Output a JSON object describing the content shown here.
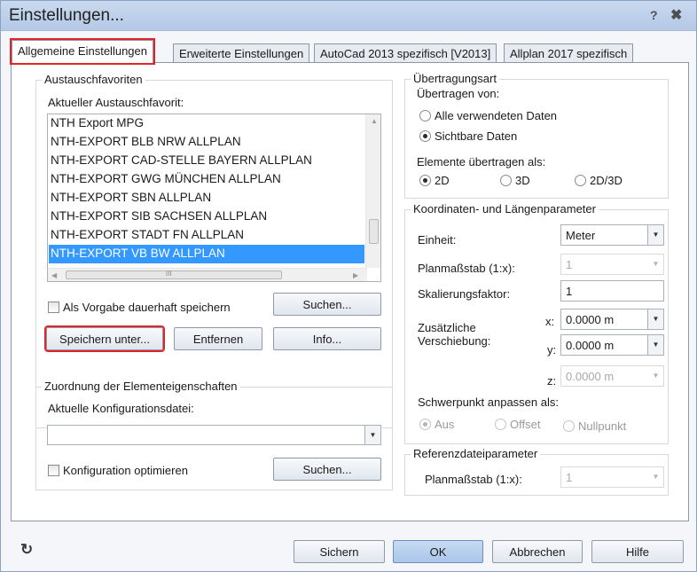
{
  "window": {
    "title": "Einstellungen...",
    "help_glyph": "?",
    "close_glyph": "✖"
  },
  "tabs": [
    {
      "label": "Allgemeine Einstellungen",
      "active": true
    },
    {
      "label": "Erweiterte Einstellungen",
      "active": false
    },
    {
      "label": "AutoCad 2013 spezifisch [V2013]",
      "active": false
    },
    {
      "label": "Allplan 2017 spezifisch",
      "active": false
    }
  ],
  "favorites": {
    "group_title": "Austauschfavoriten",
    "list_label": "Aktueller Austauschfavorit:",
    "items": [
      "NTH Export MPG",
      "NTH-EXPORT BLB NRW ALLPLAN",
      "NTH-EXPORT CAD-STELLE BAYERN ALLPLAN",
      "NTH-EXPORT GWG MÜNCHEN ALLPLAN",
      "NTH-EXPORT SBN ALLPLAN",
      "NTH-EXPORT SIB SACHSEN ALLPLAN",
      "NTH-EXPORT STADT FN ALLPLAN",
      "NTH-EXPORT VB BW ALLPLAN"
    ],
    "selected_index": 7,
    "hscroll_glyph": "III",
    "save_default_label": "Als Vorgabe dauerhaft speichern",
    "save_default_checked": false,
    "search_label": "Suchen...",
    "save_as_label": "Speichern unter...",
    "remove_label": "Entfernen",
    "info_label": "Info..."
  },
  "mapping": {
    "group_title": "Zuordnung der Elementeigenschaften",
    "config_label": "Aktuelle Konfigurationsdatei:",
    "config_value": "",
    "optimize_label": "Konfiguration optimieren",
    "optimize_checked": false,
    "search_label": "Suchen..."
  },
  "transfer": {
    "group_title": "Übertragungsart",
    "from_label": "Übertragen von:",
    "from_options": [
      {
        "label": "Alle verwendeten Daten",
        "checked": false
      },
      {
        "label": "Sichtbare Daten",
        "checked": true
      }
    ],
    "as_label": "Elemente übertragen als:",
    "as_options": [
      {
        "label": "2D",
        "checked": true
      },
      {
        "label": "3D",
        "checked": false
      },
      {
        "label": "2D/3D",
        "checked": false
      }
    ]
  },
  "coords": {
    "group_title": "Koordinaten- und Längenparameter",
    "unit_label": "Einheit:",
    "unit_value": "Meter",
    "scale_label": "Planmaßstab (1:x):",
    "scale_value": "1",
    "factor_label": "Skalierungsfaktor:",
    "factor_value": "1",
    "offset_label_1": "Zusätzliche",
    "offset_label_2": "Verschiebung:",
    "x_label": "x:",
    "x_value": "0.0000 m",
    "y_label": "y:",
    "y_value": "0.0000 m",
    "z_label": "z:",
    "z_value": "0.0000 m",
    "centroid_label": "Schwerpunkt anpassen als:",
    "centroid_options": [
      {
        "label": "Aus",
        "checked": true
      },
      {
        "label": "Offset",
        "checked": false
      },
      {
        "label": "Nullpunkt",
        "checked": false
      }
    ]
  },
  "reference": {
    "group_title": "Referenzdateiparameter",
    "scale_label": "Planmaßstab (1:x):",
    "scale_value": "1"
  },
  "footer": {
    "refresh_glyph": "↻",
    "save_label": "Sichern",
    "ok_label": "OK",
    "cancel_label": "Abbrechen",
    "help_label": "Hilfe"
  }
}
